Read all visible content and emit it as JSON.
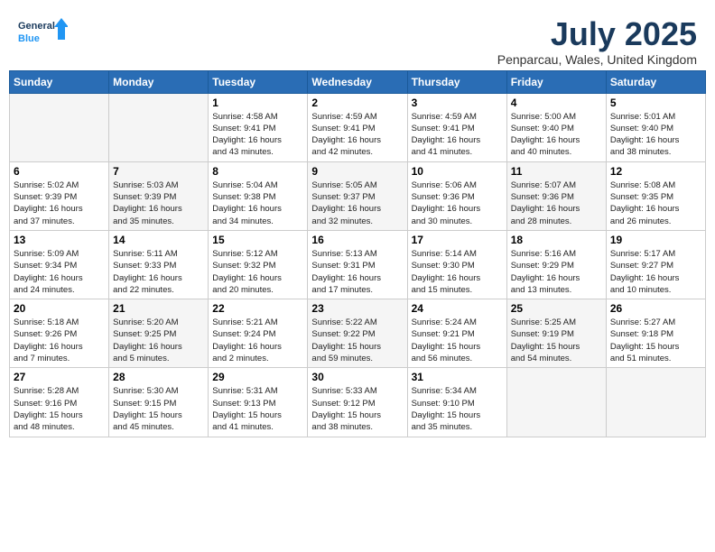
{
  "header": {
    "logo_line1": "General",
    "logo_line2": "Blue",
    "month_title": "July 2025",
    "location": "Penparcau, Wales, United Kingdom"
  },
  "days_of_week": [
    "Sunday",
    "Monday",
    "Tuesday",
    "Wednesday",
    "Thursday",
    "Friday",
    "Saturday"
  ],
  "weeks": [
    [
      {
        "day": "",
        "info": ""
      },
      {
        "day": "",
        "info": ""
      },
      {
        "day": "1",
        "info": "Sunrise: 4:58 AM\nSunset: 9:41 PM\nDaylight: 16 hours\nand 43 minutes."
      },
      {
        "day": "2",
        "info": "Sunrise: 4:59 AM\nSunset: 9:41 PM\nDaylight: 16 hours\nand 42 minutes."
      },
      {
        "day": "3",
        "info": "Sunrise: 4:59 AM\nSunset: 9:41 PM\nDaylight: 16 hours\nand 41 minutes."
      },
      {
        "day": "4",
        "info": "Sunrise: 5:00 AM\nSunset: 9:40 PM\nDaylight: 16 hours\nand 40 minutes."
      },
      {
        "day": "5",
        "info": "Sunrise: 5:01 AM\nSunset: 9:40 PM\nDaylight: 16 hours\nand 38 minutes."
      }
    ],
    [
      {
        "day": "6",
        "info": "Sunrise: 5:02 AM\nSunset: 9:39 PM\nDaylight: 16 hours\nand 37 minutes."
      },
      {
        "day": "7",
        "info": "Sunrise: 5:03 AM\nSunset: 9:39 PM\nDaylight: 16 hours\nand 35 minutes."
      },
      {
        "day": "8",
        "info": "Sunrise: 5:04 AM\nSunset: 9:38 PM\nDaylight: 16 hours\nand 34 minutes."
      },
      {
        "day": "9",
        "info": "Sunrise: 5:05 AM\nSunset: 9:37 PM\nDaylight: 16 hours\nand 32 minutes."
      },
      {
        "day": "10",
        "info": "Sunrise: 5:06 AM\nSunset: 9:36 PM\nDaylight: 16 hours\nand 30 minutes."
      },
      {
        "day": "11",
        "info": "Sunrise: 5:07 AM\nSunset: 9:36 PM\nDaylight: 16 hours\nand 28 minutes."
      },
      {
        "day": "12",
        "info": "Sunrise: 5:08 AM\nSunset: 9:35 PM\nDaylight: 16 hours\nand 26 minutes."
      }
    ],
    [
      {
        "day": "13",
        "info": "Sunrise: 5:09 AM\nSunset: 9:34 PM\nDaylight: 16 hours\nand 24 minutes."
      },
      {
        "day": "14",
        "info": "Sunrise: 5:11 AM\nSunset: 9:33 PM\nDaylight: 16 hours\nand 22 minutes."
      },
      {
        "day": "15",
        "info": "Sunrise: 5:12 AM\nSunset: 9:32 PM\nDaylight: 16 hours\nand 20 minutes."
      },
      {
        "day": "16",
        "info": "Sunrise: 5:13 AM\nSunset: 9:31 PM\nDaylight: 16 hours\nand 17 minutes."
      },
      {
        "day": "17",
        "info": "Sunrise: 5:14 AM\nSunset: 9:30 PM\nDaylight: 16 hours\nand 15 minutes."
      },
      {
        "day": "18",
        "info": "Sunrise: 5:16 AM\nSunset: 9:29 PM\nDaylight: 16 hours\nand 13 minutes."
      },
      {
        "day": "19",
        "info": "Sunrise: 5:17 AM\nSunset: 9:27 PM\nDaylight: 16 hours\nand 10 minutes."
      }
    ],
    [
      {
        "day": "20",
        "info": "Sunrise: 5:18 AM\nSunset: 9:26 PM\nDaylight: 16 hours\nand 7 minutes."
      },
      {
        "day": "21",
        "info": "Sunrise: 5:20 AM\nSunset: 9:25 PM\nDaylight: 16 hours\nand 5 minutes."
      },
      {
        "day": "22",
        "info": "Sunrise: 5:21 AM\nSunset: 9:24 PM\nDaylight: 16 hours\nand 2 minutes."
      },
      {
        "day": "23",
        "info": "Sunrise: 5:22 AM\nSunset: 9:22 PM\nDaylight: 15 hours\nand 59 minutes."
      },
      {
        "day": "24",
        "info": "Sunrise: 5:24 AM\nSunset: 9:21 PM\nDaylight: 15 hours\nand 56 minutes."
      },
      {
        "day": "25",
        "info": "Sunrise: 5:25 AM\nSunset: 9:19 PM\nDaylight: 15 hours\nand 54 minutes."
      },
      {
        "day": "26",
        "info": "Sunrise: 5:27 AM\nSunset: 9:18 PM\nDaylight: 15 hours\nand 51 minutes."
      }
    ],
    [
      {
        "day": "27",
        "info": "Sunrise: 5:28 AM\nSunset: 9:16 PM\nDaylight: 15 hours\nand 48 minutes."
      },
      {
        "day": "28",
        "info": "Sunrise: 5:30 AM\nSunset: 9:15 PM\nDaylight: 15 hours\nand 45 minutes."
      },
      {
        "day": "29",
        "info": "Sunrise: 5:31 AM\nSunset: 9:13 PM\nDaylight: 15 hours\nand 41 minutes."
      },
      {
        "day": "30",
        "info": "Sunrise: 5:33 AM\nSunset: 9:12 PM\nDaylight: 15 hours\nand 38 minutes."
      },
      {
        "day": "31",
        "info": "Sunrise: 5:34 AM\nSunset: 9:10 PM\nDaylight: 15 hours\nand 35 minutes."
      },
      {
        "day": "",
        "info": ""
      },
      {
        "day": "",
        "info": ""
      }
    ]
  ]
}
